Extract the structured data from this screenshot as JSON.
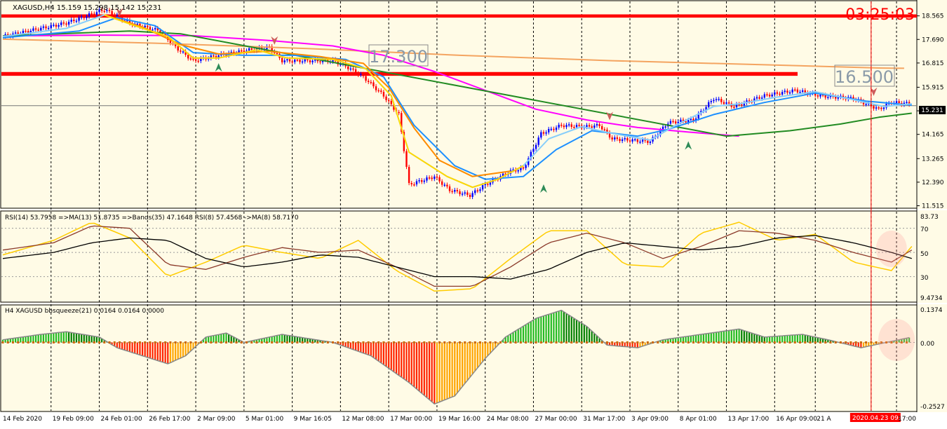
{
  "header": {
    "symbol_info": "XAGUSD,H4  15.159 15.298 15.142 15.231",
    "timer": "03:25:03"
  },
  "labels": {
    "level_upper": "17.300",
    "level_lower": "16.500",
    "current_price": "15.231"
  },
  "rsi_panel": {
    "title": "RSI(14) 53.7958  =>MA(13) 51.8735  =>Bands(35) 47.1648  RSI(8) 57.4568  ->MA(8) 58.7170",
    "ticks": [
      "83.73",
      "70",
      "50",
      "30",
      "9.4734"
    ]
  },
  "squeeze_panel": {
    "title": "H4 XAGUSD bbsqueeze(21) 0.0164 0.0164 0.0000",
    "ticks": [
      "0.1374",
      "0.00",
      "-0.2527"
    ]
  },
  "x_labels": [
    "14 Feb 2020",
    "19 Feb 09:00",
    "24 Feb 01:00",
    "26 Feb 17:00",
    "2 Mar 09:00",
    "5 Mar 01:00",
    "9 Mar 16:05",
    "12 Mar 08:00",
    "17 Mar 00:00",
    "19 Mar 16:00",
    "24 Mar 08:00",
    "27 Mar 00:00",
    "31 Mar 17:00",
    "3 Apr 09:00",
    "8 Apr 01:00",
    "13 Apr 17:00",
    "16 Apr 09:00",
    "21 A",
    "2020.04.23 09:00",
    "17:00"
  ],
  "colors": {
    "background": "#fffbe6",
    "zone": "#ff0000",
    "bull": "#0000ff",
    "bear": "#ff0000",
    "magenta_ma": "#ff00ff",
    "slow_ma": "#f4a460",
    "green_ma": "#228b22",
    "fast_orange": "#ff8c00",
    "fast_yellow": "#ffd700",
    "light_blue": "#87cefa",
    "mid_blue": "#1e90ff",
    "rsi_yellow": "#ffcc00",
    "rsi_brown": "#8b3a2a",
    "rsi_black": "#000000",
    "hist_green": "#22bb22",
    "hist_darkgreen": "#008000",
    "hist_red": "#ff2200",
    "hist_orange": "#ffa500",
    "squeeze_dot": "#cc6600",
    "cursor_line": "#ff0000"
  },
  "chart_data": [
    {
      "type": "candlestick",
      "symbol": "XAGUSD",
      "timeframe": "H4",
      "y_ticks": [
        18.565,
        17.69,
        16.815,
        15.915,
        15.04,
        14.165,
        13.265,
        12.39,
        11.515
      ],
      "ylim": [
        11.45,
        19.05
      ],
      "zones": [
        [
          18.5,
          18.62
        ],
        [
          16.34,
          16.48
        ]
      ],
      "horizontal_levels": [
        17.3,
        16.5
      ],
      "anchors": [
        [
          0,
          17.8
        ],
        [
          25,
          18.3
        ],
        [
          40,
          18.8
        ],
        [
          50,
          18.3
        ],
        [
          62,
          18.0
        ],
        [
          68,
          17.4
        ],
        [
          75,
          16.9
        ],
        [
          85,
          17.1
        ],
        [
          97,
          17.3
        ],
        [
          105,
          17.4
        ],
        [
          110,
          16.9
        ],
        [
          130,
          16.9
        ],
        [
          135,
          16.7
        ],
        [
          142,
          16.3
        ],
        [
          150,
          15.6
        ],
        [
          156,
          14.9
        ],
        [
          160,
          12.3
        ],
        [
          170,
          12.6
        ],
        [
          176,
          12.1
        ],
        [
          184,
          11.9
        ],
        [
          190,
          12.3
        ],
        [
          200,
          12.8
        ],
        [
          205,
          12.9
        ],
        [
          212,
          14.2
        ],
        [
          220,
          14.5
        ],
        [
          230,
          14.45
        ],
        [
          235,
          14.5
        ],
        [
          240,
          14.0
        ],
        [
          255,
          13.9
        ],
        [
          262,
          14.6
        ],
        [
          272,
          14.7
        ],
        [
          280,
          15.5
        ],
        [
          288,
          15.2
        ],
        [
          300,
          15.6
        ],
        [
          312,
          15.8
        ],
        [
          322,
          15.6
        ],
        [
          335,
          15.5
        ],
        [
          345,
          15.1
        ],
        [
          350,
          15.35
        ],
        [
          358,
          15.3
        ]
      ],
      "fast_ma": [
        [
          0,
          17.8
        ],
        [
          25,
          18.1
        ],
        [
          40,
          18.6
        ],
        [
          52,
          18.2
        ],
        [
          65,
          17.8
        ],
        [
          75,
          17.0
        ],
        [
          85,
          17.0
        ],
        [
          100,
          17.3
        ],
        [
          112,
          17.0
        ],
        [
          130,
          16.95
        ],
        [
          143,
          16.6
        ],
        [
          153,
          15.6
        ],
        [
          160,
          13.5
        ],
        [
          175,
          12.6
        ],
        [
          185,
          12.2
        ],
        [
          195,
          12.5
        ],
        [
          205,
          13.0
        ],
        [
          215,
          14.0
        ],
        [
          228,
          14.45
        ],
        [
          240,
          14.2
        ],
        [
          255,
          13.95
        ],
        [
          265,
          14.5
        ],
        [
          280,
          15.2
        ],
        [
          290,
          15.3
        ],
        [
          305,
          15.55
        ],
        [
          320,
          15.75
        ],
        [
          335,
          15.45
        ],
        [
          347,
          15.2
        ],
        [
          358,
          15.3
        ]
      ],
      "mid_ma": [
        [
          0,
          17.75
        ],
        [
          30,
          18.0
        ],
        [
          45,
          18.5
        ],
        [
          60,
          18.2
        ],
        [
          75,
          17.2
        ],
        [
          95,
          17.1
        ],
        [
          115,
          17.1
        ],
        [
          135,
          16.95
        ],
        [
          150,
          16.3
        ],
        [
          162,
          14.5
        ],
        [
          178,
          13.0
        ],
        [
          190,
          12.5
        ],
        [
          205,
          12.6
        ],
        [
          218,
          13.6
        ],
        [
          232,
          14.3
        ],
        [
          250,
          14.1
        ],
        [
          262,
          14.35
        ],
        [
          280,
          14.9
        ],
        [
          300,
          15.35
        ],
        [
          320,
          15.7
        ],
        [
          340,
          15.4
        ],
        [
          358,
          15.25
        ]
      ],
      "orange_ma": [
        [
          40,
          18.6
        ],
        [
          55,
          18.15
        ],
        [
          70,
          17.5
        ],
        [
          85,
          17.15
        ],
        [
          105,
          17.25
        ],
        [
          125,
          17.05
        ],
        [
          142,
          16.8
        ],
        [
          152,
          15.9
        ],
        [
          162,
          14.4
        ],
        [
          172,
          13.2
        ],
        [
          185,
          12.6
        ],
        [
          200,
          12.8
        ]
      ],
      "slow_ma": [
        [
          0,
          17.7
        ],
        [
          60,
          17.55
        ],
        [
          120,
          17.35
        ],
        [
          180,
          17.1
        ],
        [
          240,
          16.9
        ],
        [
          300,
          16.75
        ],
        [
          345,
          16.63
        ],
        [
          355,
          16.62
        ]
      ],
      "magenta_ma": [
        [
          0,
          17.82
        ],
        [
          40,
          17.85
        ],
        [
          75,
          17.83
        ],
        [
          105,
          17.65
        ],
        [
          130,
          17.45
        ],
        [
          150,
          17.1
        ],
        [
          170,
          16.5
        ],
        [
          190,
          15.8
        ],
        [
          210,
          15.1
        ],
        [
          230,
          14.7
        ],
        [
          250,
          14.42
        ],
        [
          270,
          14.25
        ],
        [
          290,
          14.1
        ]
      ],
      "green_ma": [
        [
          0,
          17.82
        ],
        [
          50,
          18.0
        ],
        [
          70,
          17.9
        ],
        [
          285,
          14.1
        ],
        [
          310,
          14.3
        ],
        [
          330,
          14.55
        ],
        [
          345,
          14.8
        ],
        [
          358,
          14.95
        ]
      ],
      "last_price": 15.231
    },
    {
      "type": "line",
      "name": "RSI",
      "ylim": [
        9.4734,
        83.73
      ],
      "x": [
        0,
        20,
        35,
        50,
        65,
        80,
        95,
        110,
        125,
        140,
        155,
        170,
        185,
        200,
        215,
        230,
        245,
        260,
        275,
        290,
        305,
        320,
        335,
        350,
        358
      ],
      "series": [
        {
          "values": [
            48,
            60,
            75,
            62,
            30,
            42,
            56,
            50,
            45,
            60,
            35,
            18,
            20,
            45,
            68,
            68,
            40,
            38,
            66,
            75,
            60,
            65,
            42,
            35,
            55
          ]
        },
        {
          "values": [
            52,
            58,
            72,
            70,
            40,
            36,
            46,
            54,
            50,
            52,
            38,
            22,
            22,
            38,
            58,
            66,
            58,
            45,
            55,
            68,
            66,
            60,
            50,
            42,
            52
          ]
        },
        {
          "values": [
            45,
            50,
            58,
            62,
            60,
            45,
            38,
            42,
            48,
            46,
            38,
            30,
            30,
            28,
            36,
            50,
            58,
            55,
            52,
            55,
            62,
            64,
            58,
            50,
            45
          ]
        }
      ]
    },
    {
      "type": "histogram",
      "name": "bbsqueeze(21)",
      "ylim": [
        -0.2527,
        0.1374
      ],
      "anchors": [
        [
          0,
          0.01
        ],
        [
          15,
          0.03
        ],
        [
          25,
          0.04
        ],
        [
          38,
          0.02
        ],
        [
          45,
          -0.02
        ],
        [
          55,
          -0.05
        ],
        [
          65,
          -0.08
        ],
        [
          72,
          -0.05
        ],
        [
          80,
          0.02
        ],
        [
          88,
          0.035
        ],
        [
          95,
          0.0
        ],
        [
          110,
          0.03
        ],
        [
          130,
          0.0
        ],
        [
          145,
          -0.05
        ],
        [
          160,
          -0.15
        ],
        [
          170,
          -0.23
        ],
        [
          178,
          -0.2
        ],
        [
          190,
          -0.06
        ],
        [
          198,
          0.02
        ],
        [
          210,
          0.09
        ],
        [
          220,
          0.12
        ],
        [
          230,
          0.06
        ],
        [
          238,
          -0.01
        ],
        [
          250,
          -0.02
        ],
        [
          260,
          0.01
        ],
        [
          275,
          0.03
        ],
        [
          290,
          0.05
        ],
        [
          300,
          0.02
        ],
        [
          315,
          0.03
        ],
        [
          325,
          0.01
        ],
        [
          338,
          -0.02
        ],
        [
          348,
          0.0
        ],
        [
          358,
          0.02
        ]
      ]
    }
  ]
}
